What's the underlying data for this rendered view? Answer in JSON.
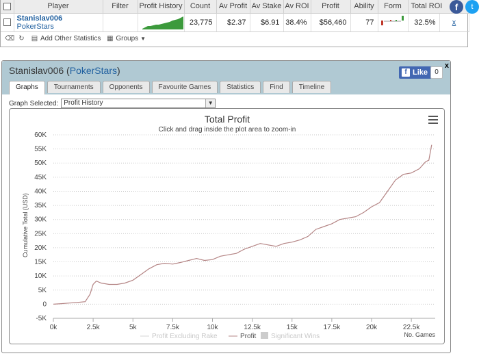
{
  "stats_table": {
    "headers": [
      "Player",
      "Filter",
      "Profit History",
      "Count",
      "Av Profit",
      "Av Stake",
      "Av ROI",
      "Profit",
      "Ability",
      "Form",
      "Total ROI"
    ],
    "row": {
      "player_name": "Stanislav006",
      "site": "PokerStars",
      "filter": "",
      "count": "23,775",
      "av_profit": "$2.37",
      "av_stake": "$6.91",
      "av_roi": "38.4%",
      "profit": "$56,460",
      "ability": "77",
      "total_roi": "32.5%",
      "close": "x"
    },
    "toolbar": {
      "add_stats_label": "Add Other Statistics",
      "groups_label": "Groups"
    }
  },
  "social": {
    "facebook": "f",
    "twitter": "t"
  },
  "panel": {
    "title_name": "Stanislav006",
    "title_site": "PokerStars",
    "like_label": "Like",
    "like_count": "0",
    "close": "x",
    "tabs": [
      "Graphs",
      "Tournaments",
      "Opponents",
      "Favourite Games",
      "Statistics",
      "Find",
      "Timeline"
    ],
    "active_tab": "Graphs",
    "graph_selected_label": "Graph Selected:",
    "graph_selected_value": "Profit History"
  },
  "colors": {
    "profit_line": "#b48484",
    "panel_header": "#b0c9d3",
    "link": "#1f5f9f",
    "spark": "#3c9a3c"
  },
  "chart_data": {
    "type": "line",
    "title": "Total Profit",
    "subtitle": "Click and drag inside the plot area to zoom-in",
    "ylabel": "Cumulative Total (USD)",
    "xlabel": "No. Games",
    "xlim": [
      0,
      24000
    ],
    "ylim": [
      -5000,
      60000
    ],
    "x_ticks": [
      0,
      2500,
      5000,
      7500,
      10000,
      12500,
      15000,
      17500,
      20000,
      22500
    ],
    "x_tick_labels": [
      "0k",
      "2.5k",
      "5k",
      "7.5k",
      "10k",
      "12.5k",
      "15k",
      "17.5k",
      "20k",
      "22.5k"
    ],
    "y_ticks": [
      -5000,
      0,
      5000,
      10000,
      15000,
      20000,
      25000,
      30000,
      35000,
      40000,
      45000,
      50000,
      55000,
      60000
    ],
    "y_tick_labels": [
      "-5K",
      "0",
      "5K",
      "10K",
      "15K",
      "20K",
      "25K",
      "30K",
      "35K",
      "40K",
      "45K",
      "50K",
      "55K",
      "60K"
    ],
    "grid": true,
    "legend": [
      "Profit Excluding Rake",
      "Profit",
      "Significant Wins"
    ],
    "series": [
      {
        "name": "Profit",
        "x": [
          0,
          500,
          1000,
          1500,
          2000,
          2300,
          2500,
          2700,
          3000,
          3500,
          4000,
          4500,
          5000,
          5500,
          6000,
          6500,
          7000,
          7500,
          8000,
          8500,
          9000,
          9500,
          10000,
          10500,
          11000,
          11500,
          12000,
          12500,
          13000,
          13500,
          14000,
          14500,
          15000,
          15500,
          16000,
          16500,
          17000,
          17500,
          18000,
          18500,
          19000,
          19500,
          20000,
          20500,
          21000,
          21500,
          22000,
          22500,
          23000,
          23400,
          23600,
          23775
        ],
        "y": [
          0,
          200,
          400,
          600,
          900,
          3500,
          7000,
          8200,
          7500,
          7000,
          7000,
          7500,
          8500,
          10500,
          12500,
          14000,
          14500,
          14200,
          14800,
          15500,
          16200,
          15500,
          15800,
          17000,
          17500,
          18000,
          19500,
          20500,
          21500,
          21000,
          20500,
          21500,
          22000,
          22800,
          24000,
          26500,
          27500,
          28500,
          30000,
          30500,
          31000,
          32500,
          34500,
          36000,
          40000,
          44000,
          46000,
          46500,
          48000,
          50500,
          51000,
          56460
        ]
      }
    ]
  }
}
